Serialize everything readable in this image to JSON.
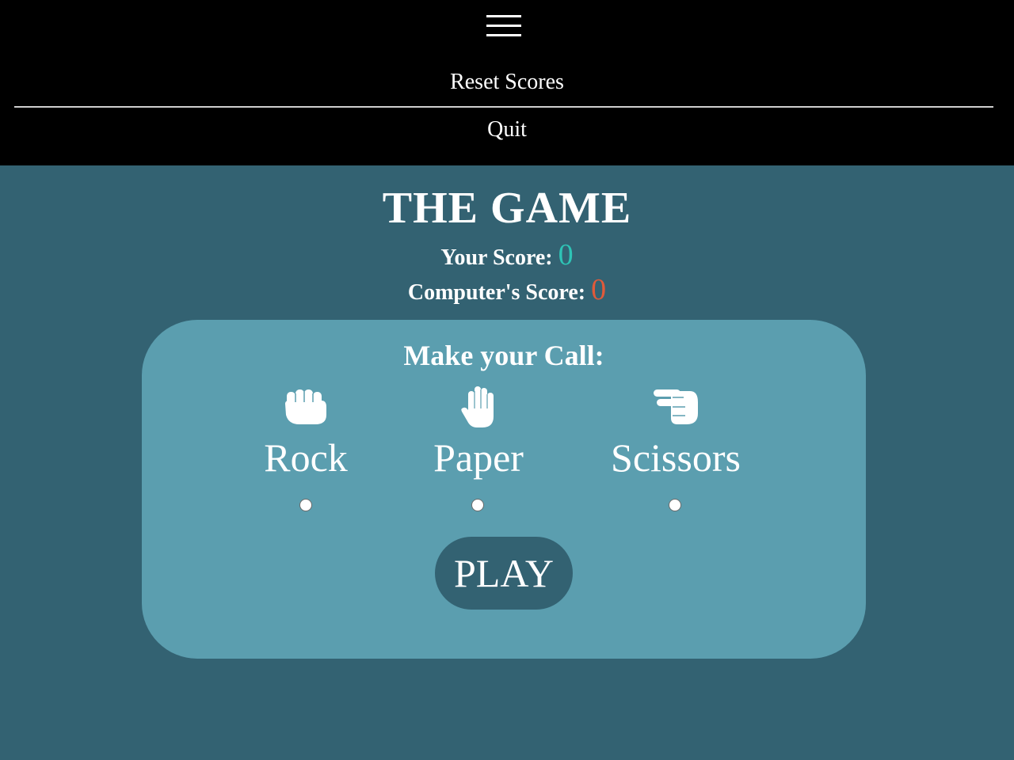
{
  "menu": {
    "items": [
      {
        "label": "Reset Scores"
      },
      {
        "label": "Quit"
      }
    ]
  },
  "game": {
    "title": "THE GAME",
    "your_score_label": "Your Score:",
    "your_score": "0",
    "computer_score_label": "Computer's Score:",
    "computer_score": "0",
    "prompt": "Make your Call:",
    "choices": [
      {
        "label": "Rock",
        "icon": "hand-fist-icon"
      },
      {
        "label": "Paper",
        "icon": "hand-open-icon"
      },
      {
        "label": "Scissors",
        "icon": "hand-scissors-icon"
      }
    ],
    "play_label": "PLAY"
  },
  "colors": {
    "page_bg": "#336272",
    "nav_bg": "#000000",
    "panel_bg": "#5b9eaf",
    "your_score": "#2ec4b6",
    "computer_score": "#e05a3a"
  }
}
